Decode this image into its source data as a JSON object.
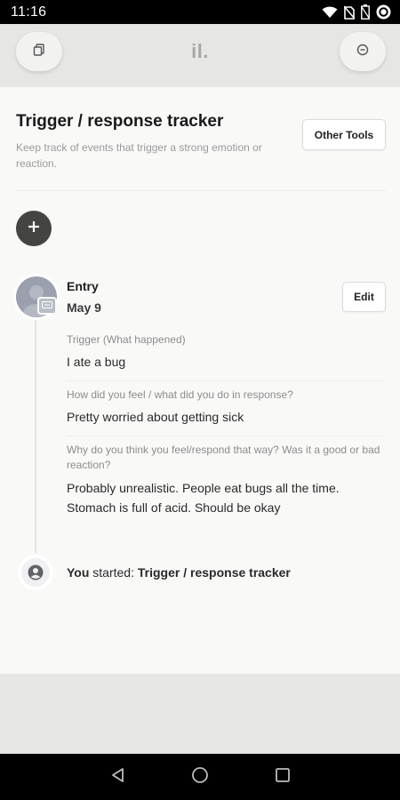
{
  "status_bar": {
    "time": "11:16",
    "icons": [
      "wifi-icon",
      "no-sim-icon",
      "battery-icon",
      "data-saver-icon"
    ]
  },
  "header": {
    "brand": "il.",
    "left_icon": "copy-icon",
    "right_icon": "settings-dot-icon"
  },
  "tool": {
    "title": "Trigger / response tracker",
    "description": "Keep track of events that trigger a strong emotion or reaction.",
    "other_tools_label": "Other Tools"
  },
  "entry": {
    "label": "Entry",
    "date": "May 9",
    "edit_label": "Edit",
    "questions": [
      {
        "question": "Trigger (What happened)",
        "answer": "I ate a bug"
      },
      {
        "question": "How did you feel / what did you do in response?",
        "answer": "Pretty worried about getting sick"
      },
      {
        "question": "Why do you think you feel/respond that way? Was it a good or bad reaction?",
        "answer": "Probably unrealistic. People eat bugs all the time. Stomach is full of acid. Should be okay"
      }
    ]
  },
  "started": {
    "you": "You",
    "verb": "started:",
    "tool_name": "Trigger / response tracker"
  },
  "colors": {
    "accent_dark": "#444442",
    "header_bg": "#e6e6e4",
    "page_bg": "#f9f9f8",
    "muted_text": "#9a9a9a"
  }
}
